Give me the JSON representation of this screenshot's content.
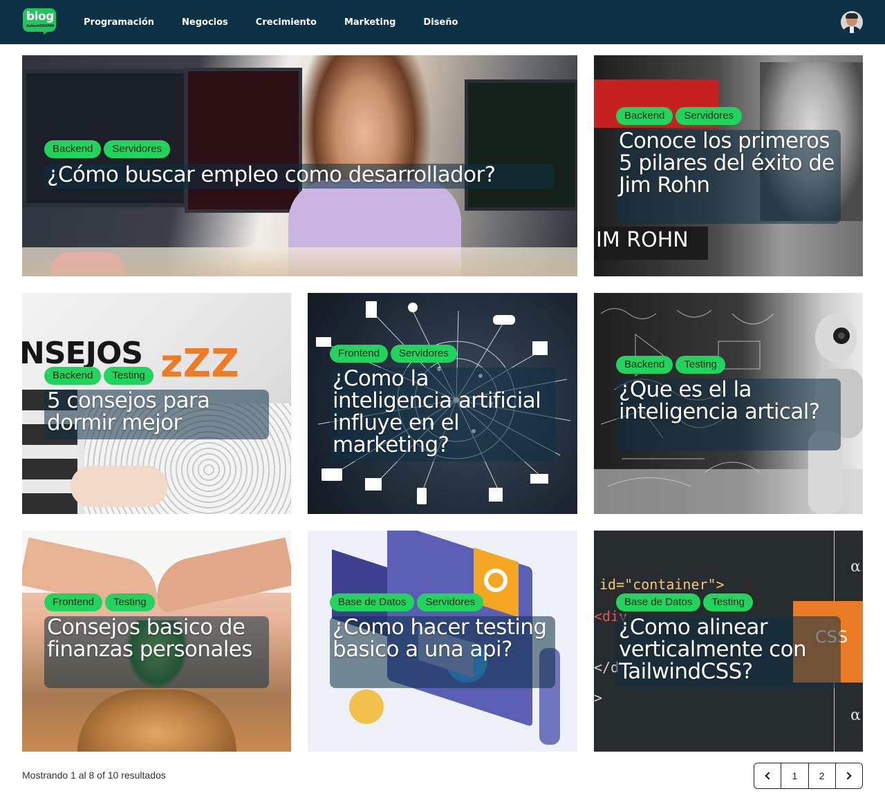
{
  "header": {
    "logo_text": "blog",
    "logo_subtext": "AulasADSKMN",
    "nav": [
      "Programación",
      "Negocios",
      "Crecimiento",
      "Marketing",
      "Diseño"
    ]
  },
  "posts": [
    {
      "tags": [
        "Backend",
        "Servidores"
      ],
      "title": "¿Cómo buscar empleo como desarrollador?"
    },
    {
      "tags": [
        "Backend",
        "Servidores"
      ],
      "title": "Conoce los primeros 5 pilares del éxito de Jim Rohn",
      "image_text": "IM ROHN"
    },
    {
      "tags": [
        "Backend",
        "Testing"
      ],
      "title": "5 consejos para dormir mejor",
      "image_text": "NSEJOS"
    },
    {
      "tags": [
        "Frontend",
        "Servidores"
      ],
      "title": "¿Como la inteligencia artificial influye en el marketing?"
    },
    {
      "tags": [
        "Backend",
        "Testing"
      ],
      "title": "¿Que es el la inteligencia artical?"
    },
    {
      "tags": [
        "Frontend",
        "Testing"
      ],
      "title": "Consejos basico de finanzas personales"
    },
    {
      "tags": [
        "Base de Datos",
        "Servidores"
      ],
      "title": "¿Como hacer testing basico a una api?"
    },
    {
      "tags": [
        "Base de Datos",
        "Testing"
      ],
      "title": "¿Como alinear verticalmente con TailwindCSS?",
      "image_code": "id=\"container\">",
      "image_badge": "CSS"
    }
  ],
  "footer": {
    "results_text": "Mostrando 1 al 8 of 10 resultados",
    "pages": [
      "1",
      "2"
    ]
  },
  "colors": {
    "header_bg": "#0c3044",
    "tag_bg": "#22d45e",
    "title_overlay": "rgba(12,48,68,0.55)"
  }
}
